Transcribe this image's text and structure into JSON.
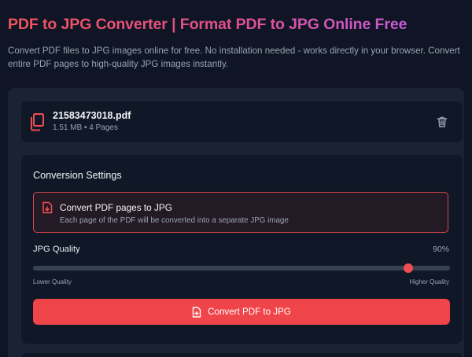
{
  "page": {
    "title": "PDF to JPG Converter | Format PDF to JPG Online Free",
    "description": "Convert PDF files to JPG images online for free. No installation needed - works directly in your browser. Convert entire PDF pages to high-quality JPG images instantly."
  },
  "file": {
    "name": "21583473018.pdf",
    "meta": "1.51 MB • 4 Pages",
    "icon": "files-icon",
    "remove_icon": "trash-icon"
  },
  "settings": {
    "title": "Conversion Settings",
    "mode": {
      "title": "Convert PDF pages to JPG",
      "description": "Each page of the PDF will be converted into a separate JPG image",
      "icon": "file-download-icon"
    },
    "quality": {
      "label": "JPG Quality",
      "value": 90,
      "value_text": "90%",
      "low_label": "Lower Quality",
      "high_label": "Higher Quality"
    },
    "convert_button": {
      "label": "Convert PDF to JPG",
      "icon": "file-convert-icon"
    }
  },
  "colors": {
    "accent": "#ef4449",
    "background": "#0f1524",
    "panel": "#1a2233",
    "card": "#101827"
  }
}
